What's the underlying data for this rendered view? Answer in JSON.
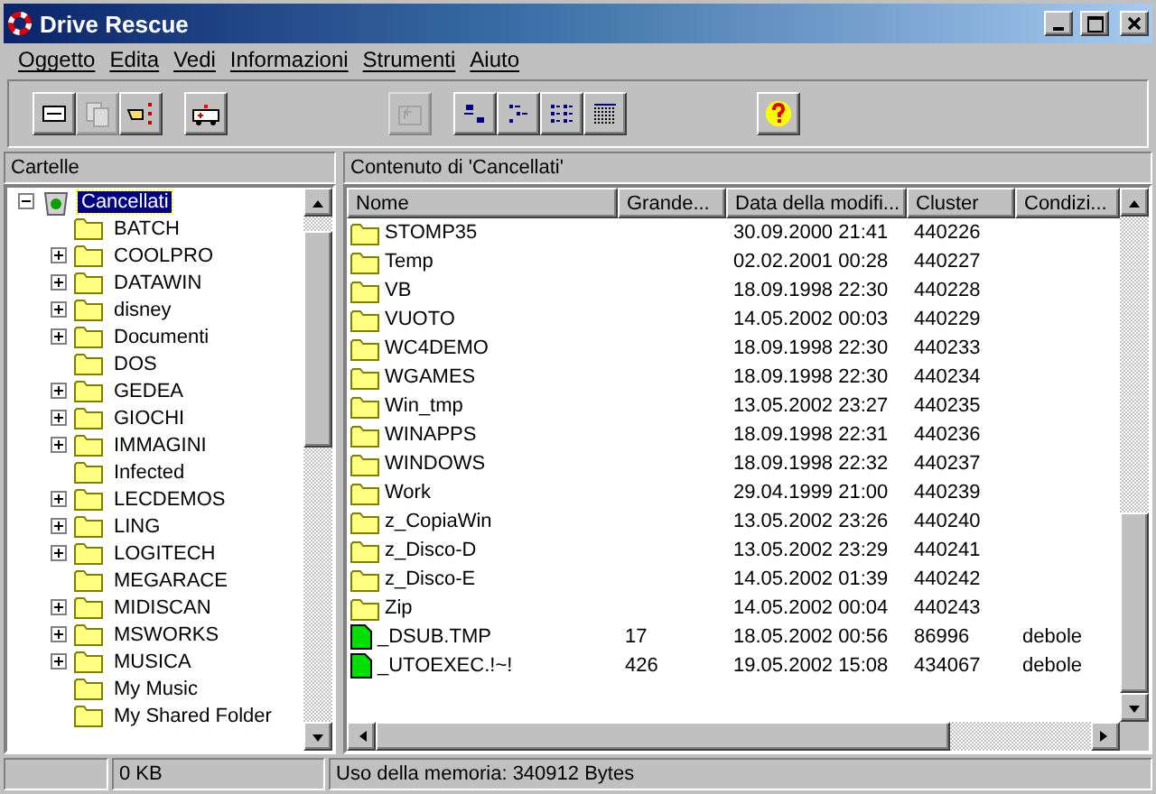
{
  "window": {
    "title": "Drive Rescue"
  },
  "menu": [
    "Oggetto",
    "Edita",
    "Vedi",
    "Informazioni",
    "Strumenti",
    "Aiuto"
  ],
  "toolbar": [
    [
      {
        "kind": "view",
        "disabled": false
      },
      {
        "kind": "copy",
        "disabled": true
      },
      {
        "kind": "point",
        "disabled": false
      }
    ],
    [
      {
        "kind": "rescue",
        "disabled": false
      }
    ],
    [
      {
        "kind": "up",
        "disabled": true
      }
    ],
    [
      {
        "kind": "large",
        "disabled": false
      },
      {
        "kind": "small",
        "disabled": false
      },
      {
        "kind": "list",
        "disabled": false
      },
      {
        "kind": "details",
        "disabled": false
      }
    ],
    [
      {
        "kind": "help",
        "disabled": false
      }
    ]
  ],
  "folders_pane": {
    "title": "Cartelle",
    "tree": [
      {
        "label": "Cancellati",
        "selected": true,
        "expanded": true,
        "children": [
          {
            "label": "BATCH",
            "selected": false
          },
          {
            "label": "COOLPRO",
            "selected": false,
            "expanded": false
          },
          {
            "label": "DATAWIN",
            "selected": false,
            "expanded": false
          },
          {
            "label": "disney",
            "selected": false,
            "expanded": false
          },
          {
            "label": "Documenti",
            "selected": false,
            "expanded": false
          },
          {
            "label": "DOS",
            "selected": false
          },
          {
            "label": "GEDEA",
            "selected": false,
            "expanded": false
          },
          {
            "label": "GIOCHI",
            "selected": false,
            "expanded": false
          },
          {
            "label": "IMMAGINI",
            "selected": false,
            "expanded": false
          },
          {
            "label": "Infected",
            "selected": false
          },
          {
            "label": "LECDEMOS",
            "selected": false,
            "expanded": false
          },
          {
            "label": "LING",
            "selected": false,
            "expanded": false
          },
          {
            "label": "LOGITECH",
            "selected": false,
            "expanded": false
          },
          {
            "label": "MEGARACE",
            "selected": false
          },
          {
            "label": "MIDISCAN",
            "selected": false,
            "expanded": false
          },
          {
            "label": "MSWORKS",
            "selected": false,
            "expanded": false
          },
          {
            "label": "MUSICA",
            "selected": false,
            "expanded": false
          },
          {
            "label": "My Music",
            "selected": false
          },
          {
            "label": "My Shared Folder",
            "selected": false
          }
        ]
      }
    ]
  },
  "contents_pane": {
    "title": "Contenuto di 'Cancellati'",
    "columns": [
      "Nome",
      "Grande...",
      "Data della modifi...",
      "Cluster",
      "Condizi..."
    ],
    "rows": [
      {
        "kind": "folder",
        "name": "STOMP35",
        "date": "30.09.2000 21:41",
        "cluster": "440226"
      },
      {
        "kind": "folder",
        "name": "Temp",
        "date": "02.02.2001 00:28",
        "cluster": "440227"
      },
      {
        "kind": "folder",
        "name": "VB",
        "date": "18.09.1998 22:30",
        "cluster": "440228"
      },
      {
        "kind": "folder",
        "name": "VUOTO",
        "date": "14.05.2002 00:03",
        "cluster": "440229"
      },
      {
        "kind": "folder",
        "name": "WC4DEMO",
        "date": "18.09.1998 22:30",
        "cluster": "440233"
      },
      {
        "kind": "folder",
        "name": "WGAMES",
        "date": "18.09.1998 22:30",
        "cluster": "440234"
      },
      {
        "kind": "folder",
        "name": "Win_tmp",
        "date": "13.05.2002 23:27",
        "cluster": "440235"
      },
      {
        "kind": "folder",
        "name": "WINAPPS",
        "date": "18.09.1998 22:31",
        "cluster": "440236"
      },
      {
        "kind": "folder",
        "name": "WINDOWS",
        "date": "18.09.1998 22:32",
        "cluster": "440237"
      },
      {
        "kind": "folder",
        "name": "Work",
        "date": "29.04.1999 21:00",
        "cluster": "440239"
      },
      {
        "kind": "folder",
        "name": "z_CopiaWin",
        "date": "13.05.2002 23:26",
        "cluster": "440240"
      },
      {
        "kind": "folder",
        "name": "z_Disco-D",
        "date": "13.05.2002 23:29",
        "cluster": "440241"
      },
      {
        "kind": "folder",
        "name": "z_Disco-E",
        "date": "14.05.2002 01:39",
        "cluster": "440242"
      },
      {
        "kind": "folder",
        "name": "Zip",
        "date": "14.05.2002 00:04",
        "cluster": "440243"
      },
      {
        "kind": "file",
        "name": "_DSUB.TMP",
        "size": "17",
        "date": "18.05.2002 00:56",
        "cluster": "86996",
        "condition": "debole"
      },
      {
        "kind": "file",
        "name": "_UTOEXEC.!~!",
        "size": "426",
        "date": "19.05.2002 15:08",
        "cluster": "434067",
        "condition": "debole"
      }
    ]
  },
  "status_bar": [
    "0 KB",
    "Uso della memoria: 340912 Bytes"
  ]
}
